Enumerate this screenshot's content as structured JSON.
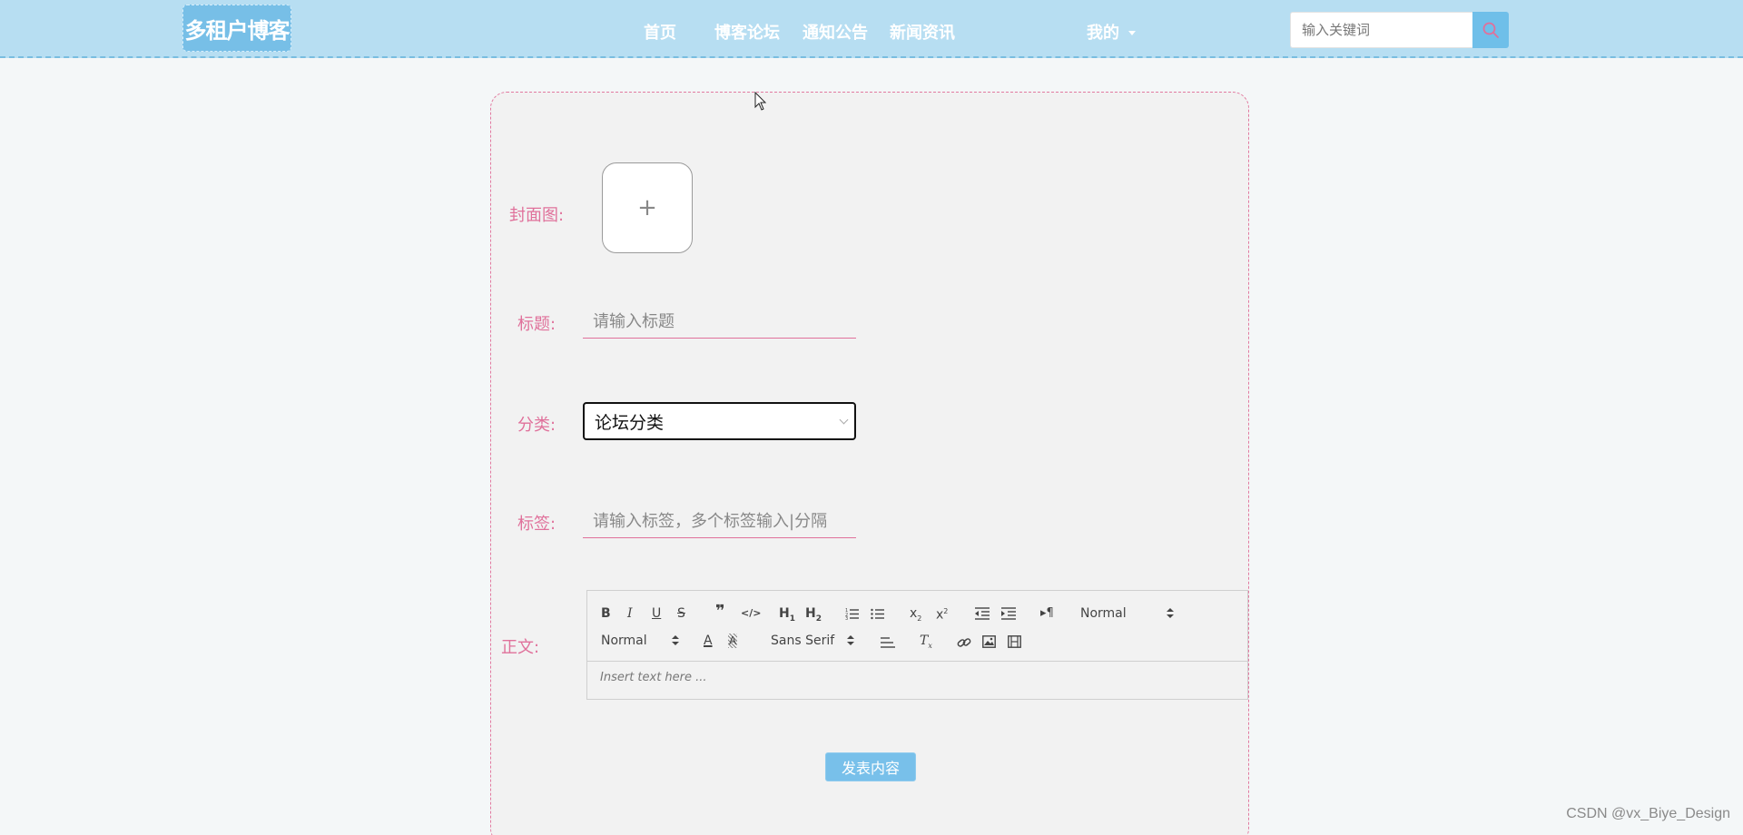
{
  "header": {
    "logo": "多租户博客",
    "nav": [
      {
        "label": "首页"
      },
      {
        "label": "博客论坛"
      },
      {
        "label": "通知公告"
      },
      {
        "label": "新闻资讯"
      }
    ],
    "mine": "我的",
    "search_placeholder": "输入关键词"
  },
  "form": {
    "cover_label": "封面图:",
    "upload_plus": "+",
    "title_label": "标题:",
    "title_placeholder": "请输入标题",
    "category_label": "分类:",
    "category_value": "论坛分类",
    "tags_label": "标签:",
    "tags_placeholder": "请输入标签，多个标签输入|分隔",
    "body_label": "正文:",
    "editor": {
      "header_select": "Normal",
      "size_select": "Normal",
      "font_select": "Sans Serif",
      "placeholder": "Insert text here ..."
    },
    "submit": "发表内容"
  },
  "watermark": "CSDN @vx_Biye_Design",
  "colors": {
    "accent": "#78c0ea",
    "label": "#e0719b",
    "header": "#b7def2"
  }
}
